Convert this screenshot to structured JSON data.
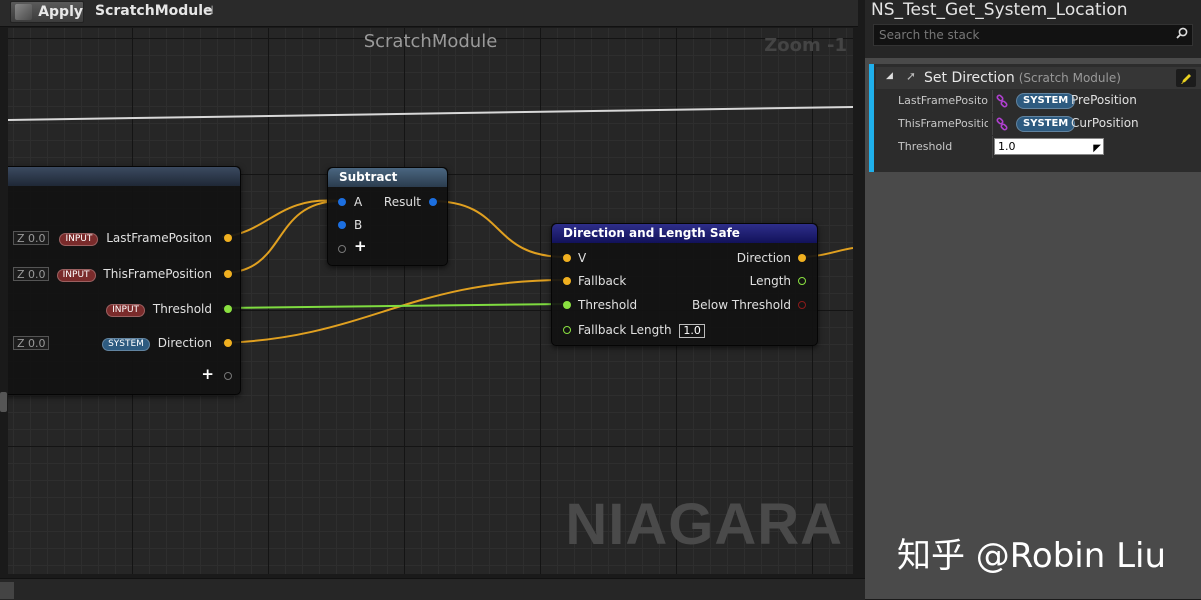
{
  "toolbar": {
    "apply_label": "Apply",
    "tab_label": "ScratchModule",
    "pin_glyph": "⊣"
  },
  "graph": {
    "title": "ScratchModule",
    "zoom": "Zoom -1",
    "watermark": "NIAGARA",
    "map_node": {
      "plus": "+",
      "pins": [
        {
          "badge": "INPUT",
          "label": "LastFramePositon",
          "z_label": "Z",
          "z_value": "0.0"
        },
        {
          "badge": "INPUT",
          "label": "ThisFramePosition",
          "z_label": "Z",
          "z_value": "0.0"
        },
        {
          "badge": "INPUT",
          "label": "Threshold"
        },
        {
          "badge": "SYSTEM",
          "label": "Direction",
          "z_label": "Z",
          "z_value": "0.0"
        }
      ]
    },
    "subtract_node": {
      "title": "Subtract",
      "in_a": "A",
      "in_b": "B",
      "out": "Result",
      "plus": "+"
    },
    "dls_node": {
      "title": "Direction and Length Safe",
      "in_v": "V",
      "in_fallback": "Fallback",
      "in_threshold": "Threshold",
      "in_fallback_length": "Fallback Length",
      "fallback_length_value": "1.0",
      "out_direction": "Direction",
      "out_length": "Length",
      "out_below": "Below Threshold"
    }
  },
  "right_panel": {
    "system_name": "NS_Test_Get_System_Location",
    "search_placeholder": "Search the stack",
    "module": {
      "name": "Set Direction",
      "type": "(Scratch Module)",
      "params": [
        {
          "name": "LastFramePositon",
          "badge": "SYSTEM",
          "value": "PrePosition"
        },
        {
          "name": "ThisFramePosition",
          "badge": "SYSTEM",
          "value": "CurPosition"
        },
        {
          "name": "Threshold",
          "value": "1.0"
        }
      ]
    },
    "credit": "知乎 @Robin Liu"
  }
}
